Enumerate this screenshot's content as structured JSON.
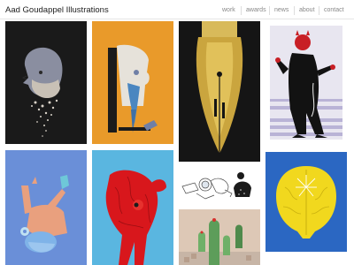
{
  "site": {
    "title": "Aad Goudappel Illustrations"
  },
  "nav": {
    "work": "work",
    "awards": "awards",
    "news": "news",
    "about": "about",
    "contact": "contact"
  },
  "colors": {
    "bald_man_bg": "#1a1a1a",
    "orange_bg": "#e99a2a",
    "pen_bg": "#151515",
    "devil_bg": "#ffffff",
    "blue_bg": "#6a8fd8",
    "cyan_bg": "#5ab6e0",
    "brain_bg": "#2b67c2",
    "brain_yellow": "#f1d81e",
    "red_figure": "#d8171c"
  },
  "tiles": [
    {
      "name": "bald-man-dissolving"
    },
    {
      "name": "ice-cream-figure"
    },
    {
      "name": "fountain-pen-nib"
    },
    {
      "name": "devil-in-suit"
    },
    {
      "name": "falling-figure"
    },
    {
      "name": "red-muscle-figure"
    },
    {
      "name": "astronaut-sketch"
    },
    {
      "name": "yellow-brain"
    },
    {
      "name": "cactus-scene"
    }
  ]
}
